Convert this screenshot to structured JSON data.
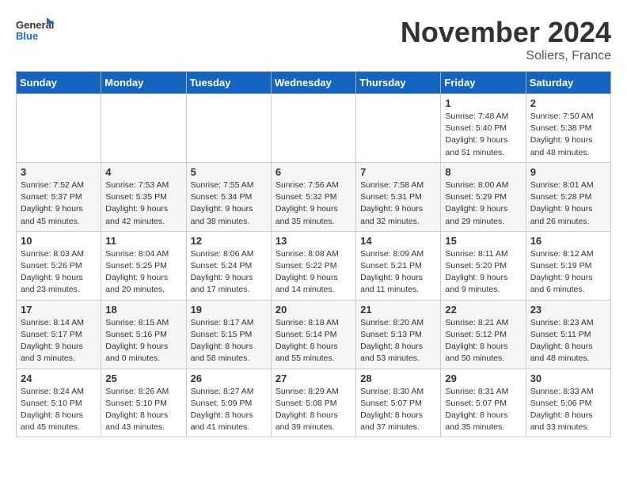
{
  "logo": {
    "line1": "General",
    "line2": "Blue"
  },
  "title": "November 2024",
  "location": "Soliers, France",
  "days_header": [
    "Sunday",
    "Monday",
    "Tuesday",
    "Wednesday",
    "Thursday",
    "Friday",
    "Saturday"
  ],
  "weeks": [
    [
      {
        "day": "",
        "info": ""
      },
      {
        "day": "",
        "info": ""
      },
      {
        "day": "",
        "info": ""
      },
      {
        "day": "",
        "info": ""
      },
      {
        "day": "",
        "info": ""
      },
      {
        "day": "1",
        "info": "Sunrise: 7:48 AM\nSunset: 5:40 PM\nDaylight: 9 hours\nand 51 minutes."
      },
      {
        "day": "2",
        "info": "Sunrise: 7:50 AM\nSunset: 5:38 PM\nDaylight: 9 hours\nand 48 minutes."
      }
    ],
    [
      {
        "day": "3",
        "info": "Sunrise: 7:52 AM\nSunset: 5:37 PM\nDaylight: 9 hours\nand 45 minutes."
      },
      {
        "day": "4",
        "info": "Sunrise: 7:53 AM\nSunset: 5:35 PM\nDaylight: 9 hours\nand 42 minutes."
      },
      {
        "day": "5",
        "info": "Sunrise: 7:55 AM\nSunset: 5:34 PM\nDaylight: 9 hours\nand 38 minutes."
      },
      {
        "day": "6",
        "info": "Sunrise: 7:56 AM\nSunset: 5:32 PM\nDaylight: 9 hours\nand 35 minutes."
      },
      {
        "day": "7",
        "info": "Sunrise: 7:58 AM\nSunset: 5:31 PM\nDaylight: 9 hours\nand 32 minutes."
      },
      {
        "day": "8",
        "info": "Sunrise: 8:00 AM\nSunset: 5:29 PM\nDaylight: 9 hours\nand 29 minutes."
      },
      {
        "day": "9",
        "info": "Sunrise: 8:01 AM\nSunset: 5:28 PM\nDaylight: 9 hours\nand 26 minutes."
      }
    ],
    [
      {
        "day": "10",
        "info": "Sunrise: 8:03 AM\nSunset: 5:26 PM\nDaylight: 9 hours\nand 23 minutes."
      },
      {
        "day": "11",
        "info": "Sunrise: 8:04 AM\nSunset: 5:25 PM\nDaylight: 9 hours\nand 20 minutes."
      },
      {
        "day": "12",
        "info": "Sunrise: 8:06 AM\nSunset: 5:24 PM\nDaylight: 9 hours\nand 17 minutes."
      },
      {
        "day": "13",
        "info": "Sunrise: 8:08 AM\nSunset: 5:22 PM\nDaylight: 9 hours\nand 14 minutes."
      },
      {
        "day": "14",
        "info": "Sunrise: 8:09 AM\nSunset: 5:21 PM\nDaylight: 9 hours\nand 11 minutes."
      },
      {
        "day": "15",
        "info": "Sunrise: 8:11 AM\nSunset: 5:20 PM\nDaylight: 9 hours\nand 9 minutes."
      },
      {
        "day": "16",
        "info": "Sunrise: 8:12 AM\nSunset: 5:19 PM\nDaylight: 9 hours\nand 6 minutes."
      }
    ],
    [
      {
        "day": "17",
        "info": "Sunrise: 8:14 AM\nSunset: 5:17 PM\nDaylight: 9 hours\nand 3 minutes."
      },
      {
        "day": "18",
        "info": "Sunrise: 8:15 AM\nSunset: 5:16 PM\nDaylight: 9 hours\nand 0 minutes."
      },
      {
        "day": "19",
        "info": "Sunrise: 8:17 AM\nSunset: 5:15 PM\nDaylight: 8 hours\nand 58 minutes."
      },
      {
        "day": "20",
        "info": "Sunrise: 8:18 AM\nSunset: 5:14 PM\nDaylight: 8 hours\nand 55 minutes."
      },
      {
        "day": "21",
        "info": "Sunrise: 8:20 AM\nSunset: 5:13 PM\nDaylight: 8 hours\nand 53 minutes."
      },
      {
        "day": "22",
        "info": "Sunrise: 8:21 AM\nSunset: 5:12 PM\nDaylight: 8 hours\nand 50 minutes."
      },
      {
        "day": "23",
        "info": "Sunrise: 8:23 AM\nSunset: 5:11 PM\nDaylight: 8 hours\nand 48 minutes."
      }
    ],
    [
      {
        "day": "24",
        "info": "Sunrise: 8:24 AM\nSunset: 5:10 PM\nDaylight: 8 hours\nand 45 minutes."
      },
      {
        "day": "25",
        "info": "Sunrise: 8:26 AM\nSunset: 5:10 PM\nDaylight: 8 hours\nand 43 minutes."
      },
      {
        "day": "26",
        "info": "Sunrise: 8:27 AM\nSunset: 5:09 PM\nDaylight: 8 hours\nand 41 minutes."
      },
      {
        "day": "27",
        "info": "Sunrise: 8:29 AM\nSunset: 5:08 PM\nDaylight: 8 hours\nand 39 minutes."
      },
      {
        "day": "28",
        "info": "Sunrise: 8:30 AM\nSunset: 5:07 PM\nDaylight: 8 hours\nand 37 minutes."
      },
      {
        "day": "29",
        "info": "Sunrise: 8:31 AM\nSunset: 5:07 PM\nDaylight: 8 hours\nand 35 minutes."
      },
      {
        "day": "30",
        "info": "Sunrise: 8:33 AM\nSunset: 5:06 PM\nDaylight: 8 hours\nand 33 minutes."
      }
    ]
  ]
}
